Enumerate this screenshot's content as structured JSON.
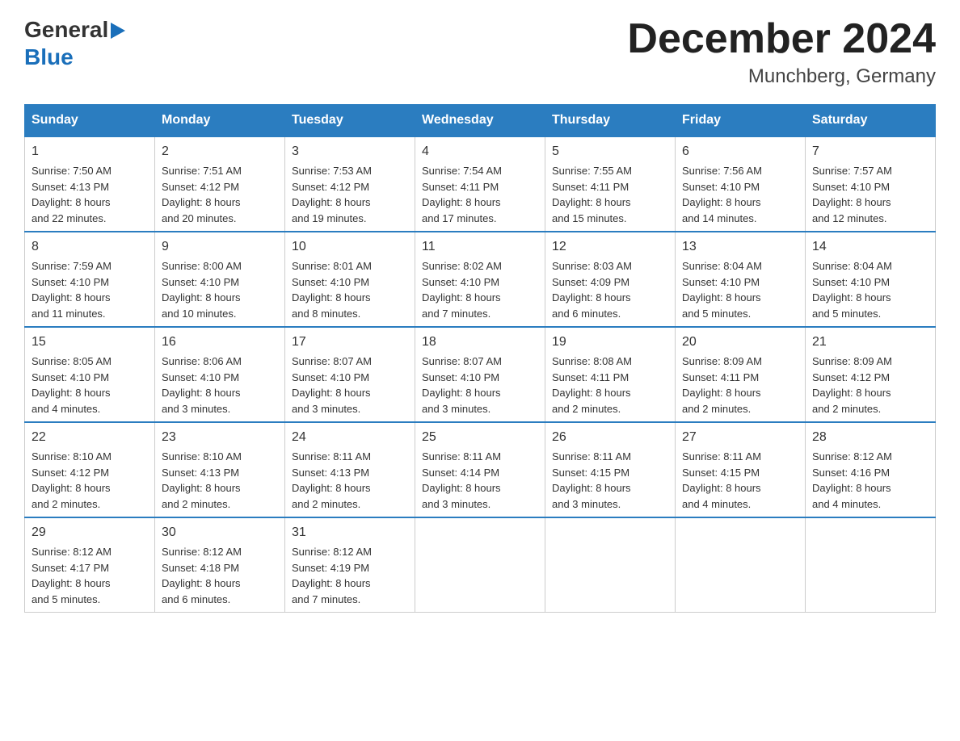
{
  "logo": {
    "line1": "General",
    "line2": "Blue"
  },
  "header": {
    "title": "December 2024",
    "subtitle": "Munchberg, Germany"
  },
  "days_of_week": [
    "Sunday",
    "Monday",
    "Tuesday",
    "Wednesday",
    "Thursday",
    "Friday",
    "Saturday"
  ],
  "weeks": [
    [
      {
        "day": "1",
        "sunrise": "7:50 AM",
        "sunset": "4:13 PM",
        "daylight": "8 hours and 22 minutes."
      },
      {
        "day": "2",
        "sunrise": "7:51 AM",
        "sunset": "4:12 PM",
        "daylight": "8 hours and 20 minutes."
      },
      {
        "day": "3",
        "sunrise": "7:53 AM",
        "sunset": "4:12 PM",
        "daylight": "8 hours and 19 minutes."
      },
      {
        "day": "4",
        "sunrise": "7:54 AM",
        "sunset": "4:11 PM",
        "daylight": "8 hours and 17 minutes."
      },
      {
        "day": "5",
        "sunrise": "7:55 AM",
        "sunset": "4:11 PM",
        "daylight": "8 hours and 15 minutes."
      },
      {
        "day": "6",
        "sunrise": "7:56 AM",
        "sunset": "4:10 PM",
        "daylight": "8 hours and 14 minutes."
      },
      {
        "day": "7",
        "sunrise": "7:57 AM",
        "sunset": "4:10 PM",
        "daylight": "8 hours and 12 minutes."
      }
    ],
    [
      {
        "day": "8",
        "sunrise": "7:59 AM",
        "sunset": "4:10 PM",
        "daylight": "8 hours and 11 minutes."
      },
      {
        "day": "9",
        "sunrise": "8:00 AM",
        "sunset": "4:10 PM",
        "daylight": "8 hours and 10 minutes."
      },
      {
        "day": "10",
        "sunrise": "8:01 AM",
        "sunset": "4:10 PM",
        "daylight": "8 hours and 8 minutes."
      },
      {
        "day": "11",
        "sunrise": "8:02 AM",
        "sunset": "4:10 PM",
        "daylight": "8 hours and 7 minutes."
      },
      {
        "day": "12",
        "sunrise": "8:03 AM",
        "sunset": "4:09 PM",
        "daylight": "8 hours and 6 minutes."
      },
      {
        "day": "13",
        "sunrise": "8:04 AM",
        "sunset": "4:10 PM",
        "daylight": "8 hours and 5 minutes."
      },
      {
        "day": "14",
        "sunrise": "8:04 AM",
        "sunset": "4:10 PM",
        "daylight": "8 hours and 5 minutes."
      }
    ],
    [
      {
        "day": "15",
        "sunrise": "8:05 AM",
        "sunset": "4:10 PM",
        "daylight": "8 hours and 4 minutes."
      },
      {
        "day": "16",
        "sunrise": "8:06 AM",
        "sunset": "4:10 PM",
        "daylight": "8 hours and 3 minutes."
      },
      {
        "day": "17",
        "sunrise": "8:07 AM",
        "sunset": "4:10 PM",
        "daylight": "8 hours and 3 minutes."
      },
      {
        "day": "18",
        "sunrise": "8:07 AM",
        "sunset": "4:10 PM",
        "daylight": "8 hours and 3 minutes."
      },
      {
        "day": "19",
        "sunrise": "8:08 AM",
        "sunset": "4:11 PM",
        "daylight": "8 hours and 2 minutes."
      },
      {
        "day": "20",
        "sunrise": "8:09 AM",
        "sunset": "4:11 PM",
        "daylight": "8 hours and 2 minutes."
      },
      {
        "day": "21",
        "sunrise": "8:09 AM",
        "sunset": "4:12 PM",
        "daylight": "8 hours and 2 minutes."
      }
    ],
    [
      {
        "day": "22",
        "sunrise": "8:10 AM",
        "sunset": "4:12 PM",
        "daylight": "8 hours and 2 minutes."
      },
      {
        "day": "23",
        "sunrise": "8:10 AM",
        "sunset": "4:13 PM",
        "daylight": "8 hours and 2 minutes."
      },
      {
        "day": "24",
        "sunrise": "8:11 AM",
        "sunset": "4:13 PM",
        "daylight": "8 hours and 2 minutes."
      },
      {
        "day": "25",
        "sunrise": "8:11 AM",
        "sunset": "4:14 PM",
        "daylight": "8 hours and 3 minutes."
      },
      {
        "day": "26",
        "sunrise": "8:11 AM",
        "sunset": "4:15 PM",
        "daylight": "8 hours and 3 minutes."
      },
      {
        "day": "27",
        "sunrise": "8:11 AM",
        "sunset": "4:15 PM",
        "daylight": "8 hours and 4 minutes."
      },
      {
        "day": "28",
        "sunrise": "8:12 AM",
        "sunset": "4:16 PM",
        "daylight": "8 hours and 4 minutes."
      }
    ],
    [
      {
        "day": "29",
        "sunrise": "8:12 AM",
        "sunset": "4:17 PM",
        "daylight": "8 hours and 5 minutes."
      },
      {
        "day": "30",
        "sunrise": "8:12 AM",
        "sunset": "4:18 PM",
        "daylight": "8 hours and 6 minutes."
      },
      {
        "day": "31",
        "sunrise": "8:12 AM",
        "sunset": "4:19 PM",
        "daylight": "8 hours and 7 minutes."
      },
      null,
      null,
      null,
      null
    ]
  ],
  "labels": {
    "sunrise": "Sunrise:",
    "sunset": "Sunset:",
    "daylight": "Daylight:"
  }
}
